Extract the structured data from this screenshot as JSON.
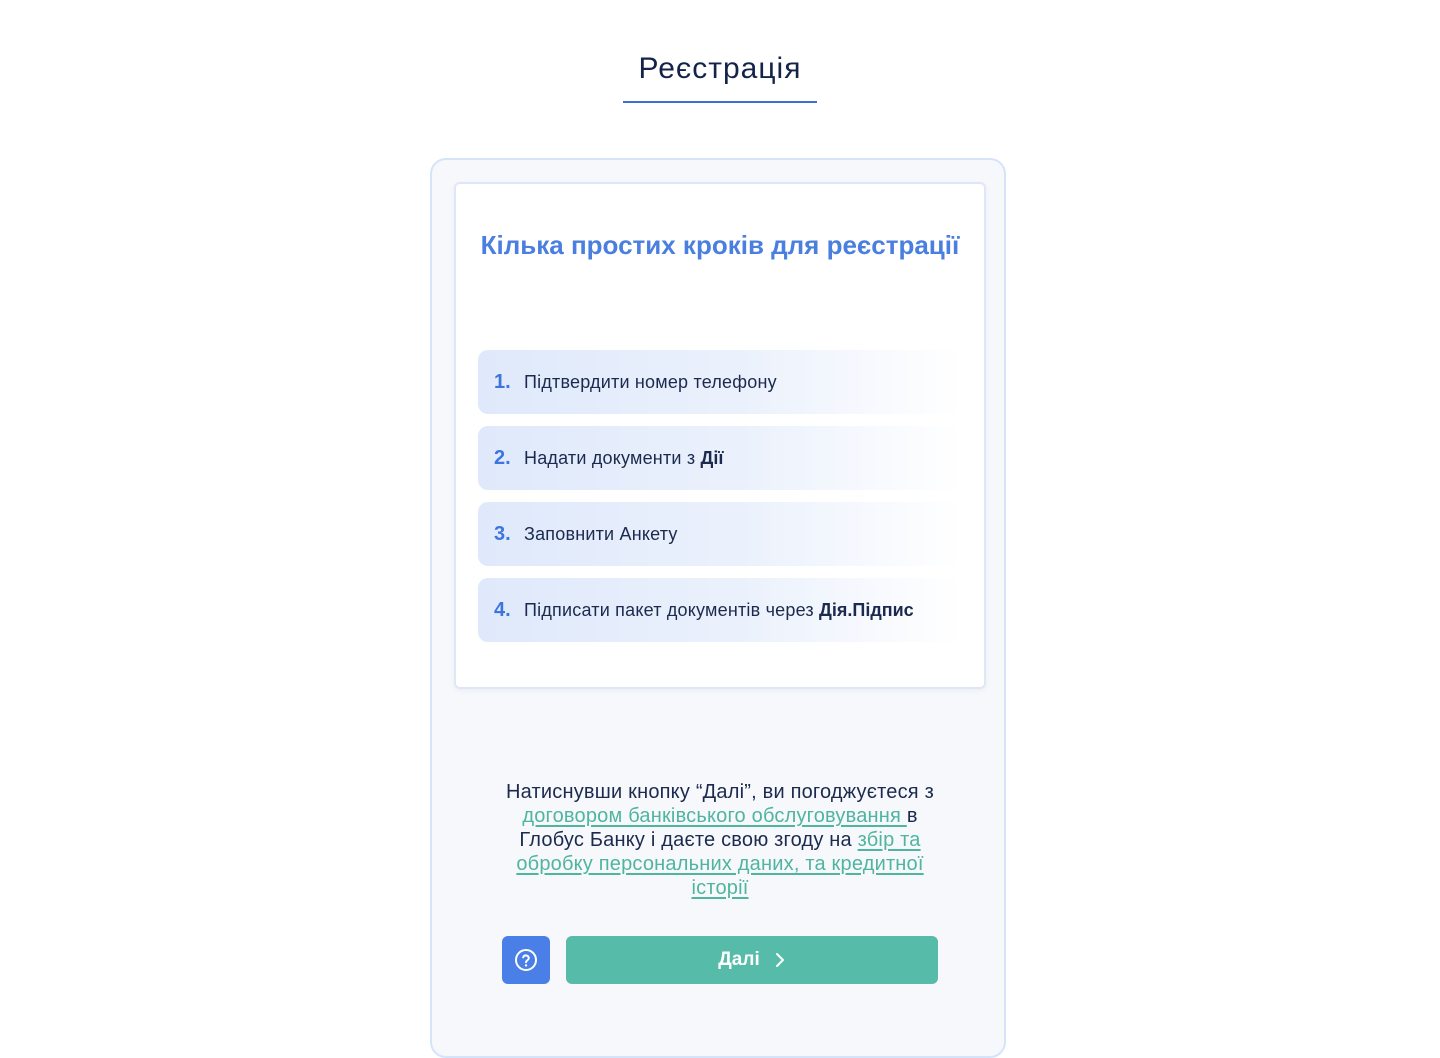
{
  "header": {
    "title": "Реєстрація"
  },
  "card": {
    "title": "Кілька простих кроків для реєстрації",
    "steps": [
      {
        "number": "1.",
        "text": "Підтвердити номер телефону",
        "bold": ""
      },
      {
        "number": "2.",
        "text": "Надати документи з ",
        "bold": "Дії"
      },
      {
        "number": "3.",
        "text": "Заповнити Анкету",
        "bold": ""
      },
      {
        "number": "4.",
        "text": "Підписати пакет документів через ",
        "bold": "Дія.Підпис"
      }
    ]
  },
  "consent": {
    "part1": "Натиснувши кнопку “Далі”, ви погоджуєтеся з ",
    "link1": "договором банківського обслуговування ",
    "part2": "в Глобус Банку і даєте свою згоду на ",
    "link2": "збір та обробку персональних даних, та кредитної історії"
  },
  "actions": {
    "help_icon": "question-circle-icon",
    "next_label": "Далі",
    "next_icon": "chevron-right-icon"
  },
  "colors": {
    "accent_blue": "#4a7fe0",
    "accent_green": "#56bca9",
    "text_dark": "#1b2a4e"
  }
}
